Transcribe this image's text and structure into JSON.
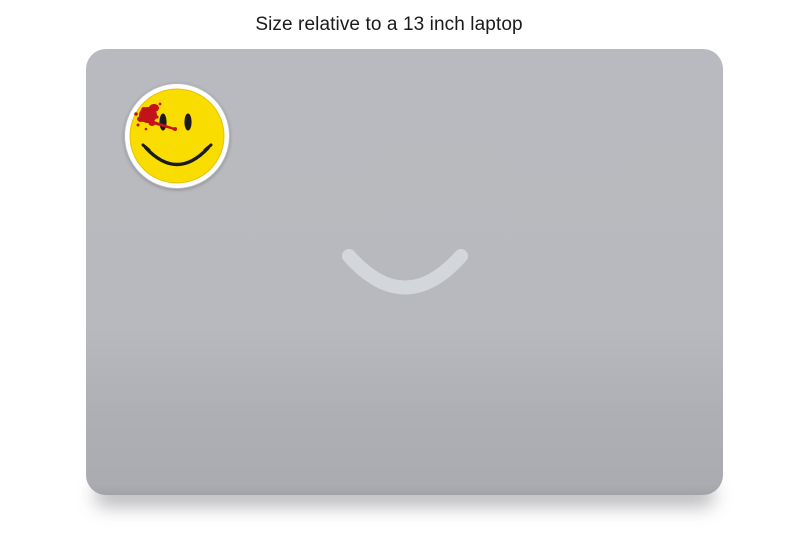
{
  "caption": "Size relative to a 13 inch laptop",
  "icons": {
    "laptop_logo": "smile-logo-icon",
    "sticker": "bloodied-smiley-icon"
  },
  "colors": {
    "background": "#ffffff",
    "laptop_lid": "#b9babf",
    "logo": "#d3d6da",
    "sticker_yellow": "#f9dc00",
    "sticker_border": "#ffffff",
    "blood": "#c4121b"
  }
}
